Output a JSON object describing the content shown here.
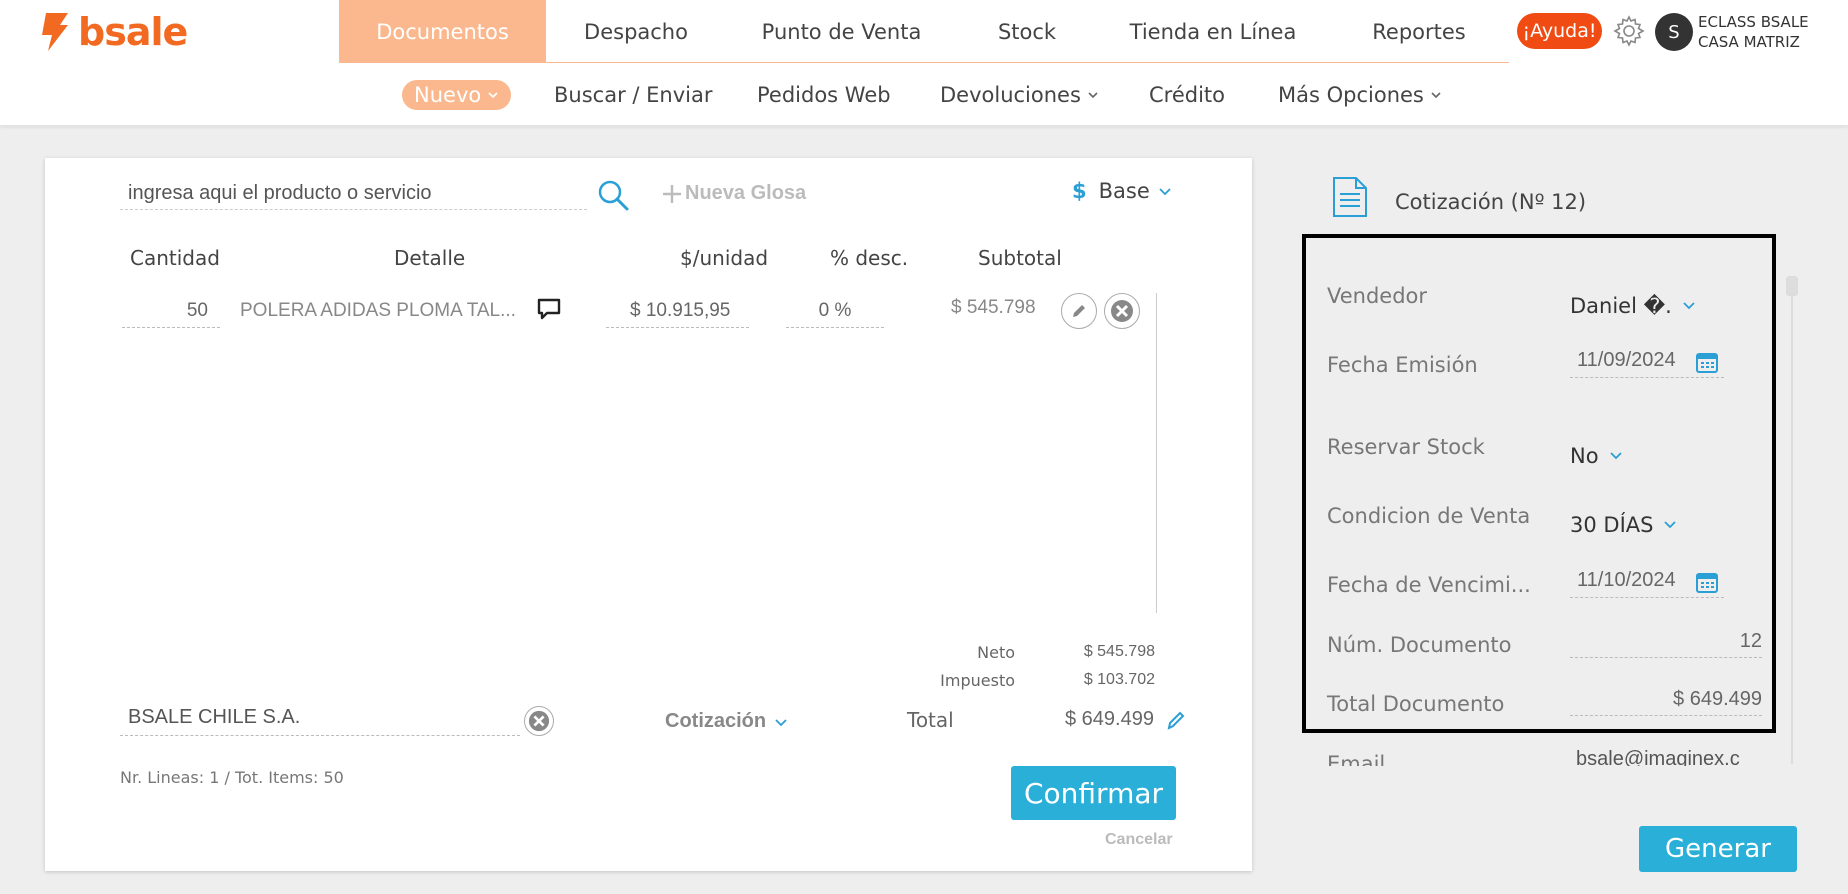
{
  "brand": {
    "logo_text": "bsale",
    "accent": "#f26a21"
  },
  "main_nav": [
    {
      "label": "Documentos",
      "active": true
    },
    {
      "label": "Despacho"
    },
    {
      "label": "Punto de Venta"
    },
    {
      "label": "Stock"
    },
    {
      "label": "Tienda en Línea"
    },
    {
      "label": "Reportes"
    }
  ],
  "header": {
    "help_label": "¡Ayuda!",
    "avatar_initial": "S",
    "company_line1": "ECLASS BSALE",
    "company_line2": "CASA MATRIZ"
  },
  "sub_nav": {
    "nuevo": "Nuevo",
    "buscar": "Buscar / Enviar",
    "pedidos": "Pedidos Web",
    "devoluciones": "Devoluciones",
    "credito": "Crédito",
    "mas": "Más Opciones"
  },
  "editor": {
    "search_placeholder": "ingresa aqui el producto o servicio",
    "nueva_glosa": "Nueva Glosa",
    "price_list_symbol": "$",
    "price_list": "Base",
    "columns": {
      "cantidad": "Cantidad",
      "detalle": "Detalle",
      "unidad": "$/unidad",
      "desc": "% desc.",
      "subtotal": "Subtotal"
    },
    "row": {
      "cantidad": "50",
      "detalle": "POLERA ADIDAS PLOMA TAL...",
      "unidad": "$ 10.915,95",
      "desc": "0 %",
      "subtotal": "$ 545.798"
    },
    "totals": {
      "neto_label": "Neto",
      "neto": "$ 545.798",
      "impuesto_label": "Impuesto",
      "impuesto": "$ 103.702",
      "total_label": "Total",
      "total": "$ 649.499"
    },
    "client": "BSALE CHILE S.A.",
    "doc_type": "Cotización",
    "lines_info": "Nr. Lineas: 1 / Tot. Items: 50",
    "confirm": "Confirmar",
    "cancel": "Cancelar"
  },
  "side": {
    "title": "Cotización (Nº 12)",
    "vendedor_label": "Vendedor",
    "vendedor": "Daniel �.",
    "fecha_emision_label": "Fecha Emisión",
    "fecha_emision": "11/09/2024",
    "reservar_label": "Reservar Stock",
    "reservar": "No",
    "condicion_label": "Condicion de Venta",
    "condicion": "30 DÍAS",
    "vencimiento_label": "Fecha de Vencimi...",
    "vencimiento": "11/10/2024",
    "num_label": "Núm. Documento",
    "num": "12",
    "total_label": "Total Documento",
    "total": "$ 649.499",
    "email_label": "Email",
    "email": "bsale@imaginex.c",
    "generate": "Generar"
  }
}
